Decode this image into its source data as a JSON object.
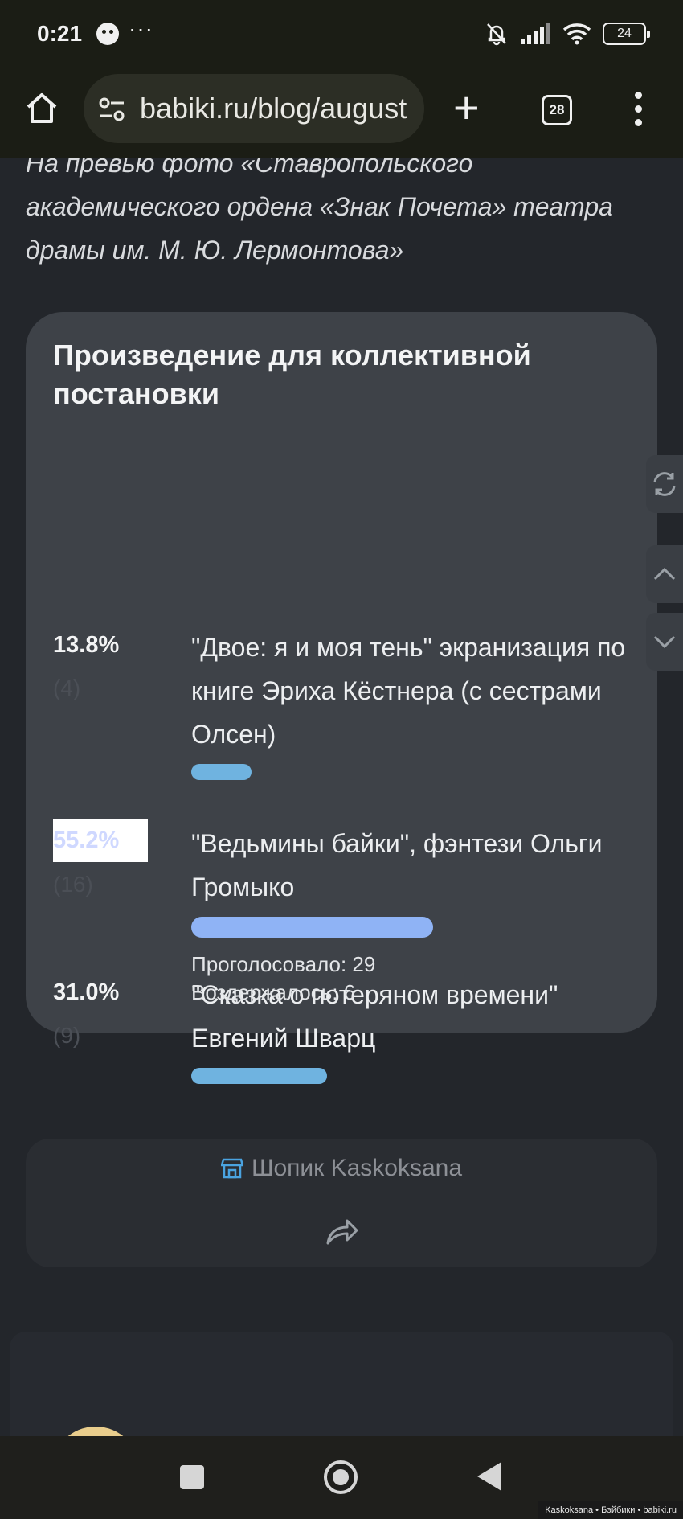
{
  "status_bar": {
    "time": "0:21",
    "dots": "···",
    "battery": "24"
  },
  "browser": {
    "url": "babiki.ru/blog/august",
    "tab_count": "28"
  },
  "caption": "На превью фото «Ставропольского академического ордена «Знак Почета» театра драмы им. М. Ю. Лермонтова»",
  "poll": {
    "title": "Произведение для коллективной постановки",
    "options": [
      {
        "percent": "13.8%",
        "count": "(4)",
        "text": "\"Двое: я и моя тень\" экранизация по книге Эриха Кёстнера (с сестрами Олсен)",
        "share": 0.138,
        "color": "#6fb3e0"
      },
      {
        "percent": "55.2%",
        "count": "(16)",
        "text": "\"Ведьмины байки\", фэнтези Ольги Громыко",
        "share": 0.552,
        "color": "#8fb3f5"
      },
      {
        "percent": "31.0%",
        "count": "(9)",
        "text": "\"Сказка о потеряном времени\" Евгений Шварц",
        "share": 0.31,
        "color": "#6fb3e0"
      }
    ],
    "voted": "Проголосовало: 29",
    "abstained": "Воздержалось: 6"
  },
  "shop": {
    "label": "Шопик Kaskoksana"
  },
  "watermark": "Kaskoksana • Бэйбики • babiki.ru"
}
